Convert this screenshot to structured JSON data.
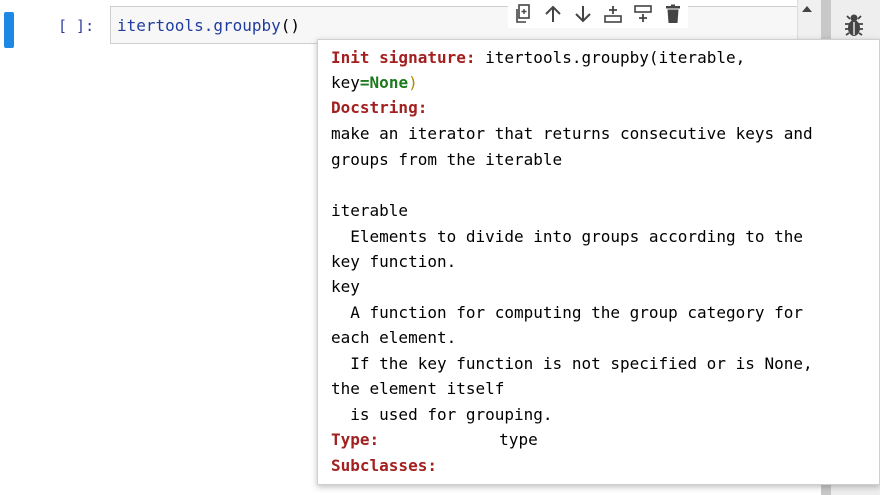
{
  "cell": {
    "prompt": "[ ]:",
    "code_fn": "itertools.groupby",
    "code_parens": "()"
  },
  "toolbar": {
    "icons": [
      "copy-icon",
      "move-up-icon",
      "move-down-icon",
      "insert-above-icon",
      "insert-below-icon",
      "delete-icon"
    ]
  },
  "sidebar": {
    "icon": "bug-icon"
  },
  "tooltip": {
    "init_label": "Init signature:",
    "init_sig_1": "itertools.groupby(iterable,",
    "init_sig_2_key": "key",
    "init_sig_2_eq": "=",
    "init_sig_2_none": "None",
    "init_sig_2_close": ")",
    "docstring_label": "Docstring:",
    "doc_lines": [
      "make an iterator that returns consecutive keys and",
      "groups from the iterable",
      "",
      "iterable",
      "  Elements to divide into groups according to the",
      "key function.",
      "key",
      "  A function for computing the group category for",
      "each element.",
      "  If the key function is not specified or is None,",
      "the element itself",
      "  is used for grouping."
    ],
    "type_label": "Type:",
    "type_value": "type",
    "subclasses_label": "Subclasses:"
  }
}
